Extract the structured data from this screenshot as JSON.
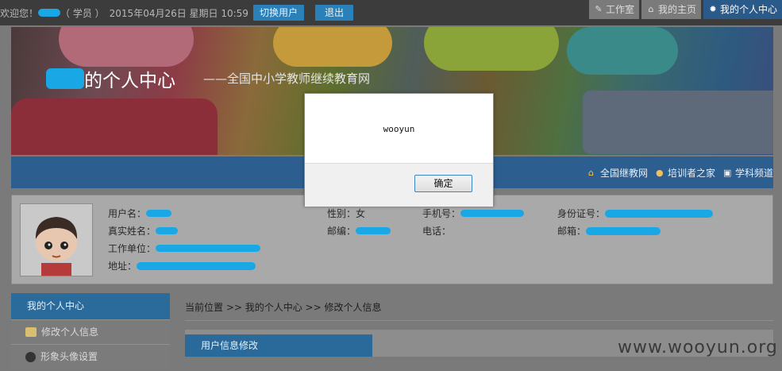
{
  "topbar": {
    "welcome": "欢迎您！",
    "role": "（ 学员 ）",
    "datetime": "2015年04月26日 星期日 10:59",
    "switch_user": "切换用户",
    "logout": "退出",
    "nav": [
      {
        "label": "工作室",
        "icon": "edit-icon"
      },
      {
        "label": "我的主页",
        "icon": "home-icon"
      },
      {
        "label": "我的个人中心",
        "icon": "gear-icon",
        "active": true
      }
    ]
  },
  "banner": {
    "title_suffix": "的个人中心",
    "subtitle": "——全国中小学教师继续教育网"
  },
  "linkbar": [
    {
      "label": "全国继教网",
      "icon": "home-icon"
    },
    {
      "label": "培训者之家",
      "icon": "users-icon"
    },
    {
      "label": "学科频道",
      "icon": "monitor-icon"
    }
  ],
  "profile": {
    "username_label": "用户名：",
    "realname_label": "真实姓名：",
    "org_label": "工作单位：",
    "address_label": "地址：",
    "gender_label": "性别：",
    "gender_value": "女",
    "postcode_label": "邮编：",
    "phone_label": "手机号：",
    "tel_label": "电话：",
    "id_label": "身份证号：",
    "email_label": "邮箱："
  },
  "leftnav": {
    "head": "我的个人中心",
    "items": [
      {
        "label": "修改个人信息",
        "icon": "profile-card-icon"
      },
      {
        "label": "形象头像设置",
        "icon": "avatar-icon"
      }
    ]
  },
  "breadcrumb": "当前位置 >> 我的个人中心 >> 修改个人信息",
  "tab": "用户信息修改",
  "watermark": "www.wooyun.org",
  "dialog": {
    "message": "wooyun",
    "ok": "确定"
  }
}
